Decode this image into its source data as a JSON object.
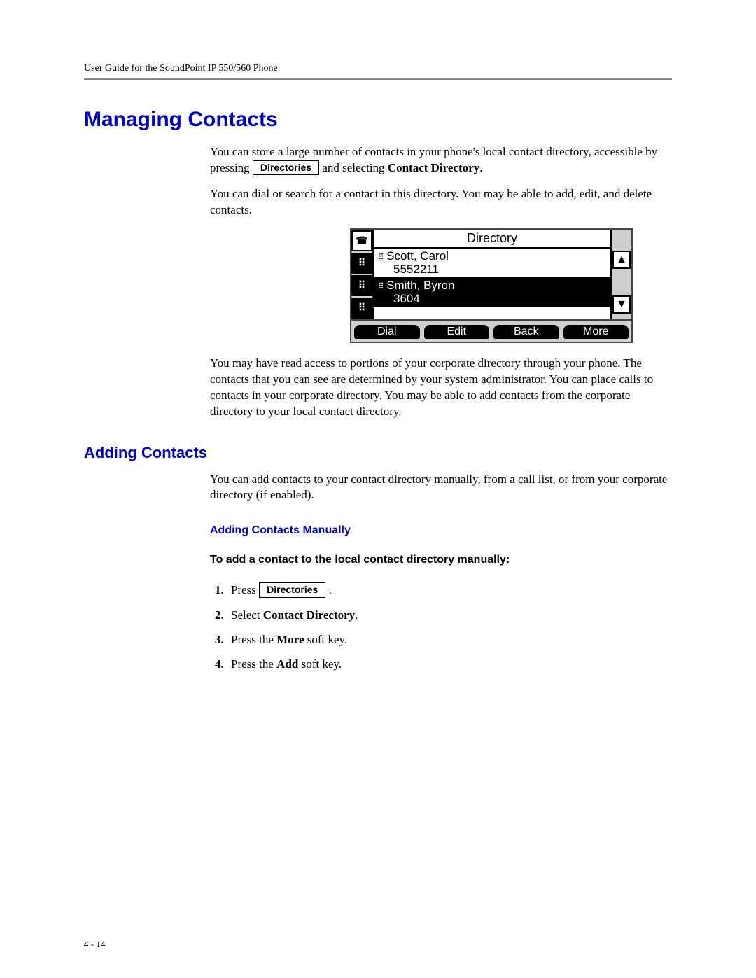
{
  "header": "User Guide for the SoundPoint IP 550/560 Phone",
  "h1": "Managing Contacts",
  "p1a": "You can store a large number of contacts in your phone's local contact directory, accessible by pressing ",
  "key_directories": "Directories",
  "p1b": " and selecting ",
  "p1c": "Contact Directory",
  "p1d": ".",
  "p2": "You can dial or search for a contact in this directory. You may be able to add, edit, and delete contacts.",
  "screen": {
    "title": "Directory",
    "contacts": [
      {
        "name": "Scott, Carol",
        "number": "5552211",
        "selected": false
      },
      {
        "name": "Smith, Byron",
        "number": "3604",
        "selected": true
      }
    ],
    "softkeys": [
      "Dial",
      "Edit",
      "Back",
      "More"
    ]
  },
  "p3": "You may have read access to portions of your corporate directory through your phone. The contacts that you can see are determined by your system administrator. You can place calls to contacts in your corporate directory. You may be able to add contacts from the corporate directory to your local contact directory.",
  "h2": "Adding Contacts",
  "p4": "You can add contacts to your contact directory manually, from a call list, or from your corporate directory (if enabled).",
  "h3": "Adding Contacts Manually",
  "instruction_heading": "To add a contact to the local contact directory manually:",
  "steps": {
    "s1a": "Press ",
    "s1b": " .",
    "s2a": "Select ",
    "s2b": "Contact Directory",
    "s2c": ".",
    "s3a": "Press the ",
    "s3b": "More",
    "s3c": " soft key.",
    "s4a": "Press the ",
    "s4b": "Add",
    "s4c": " soft key."
  },
  "page_number": "4 - 14"
}
